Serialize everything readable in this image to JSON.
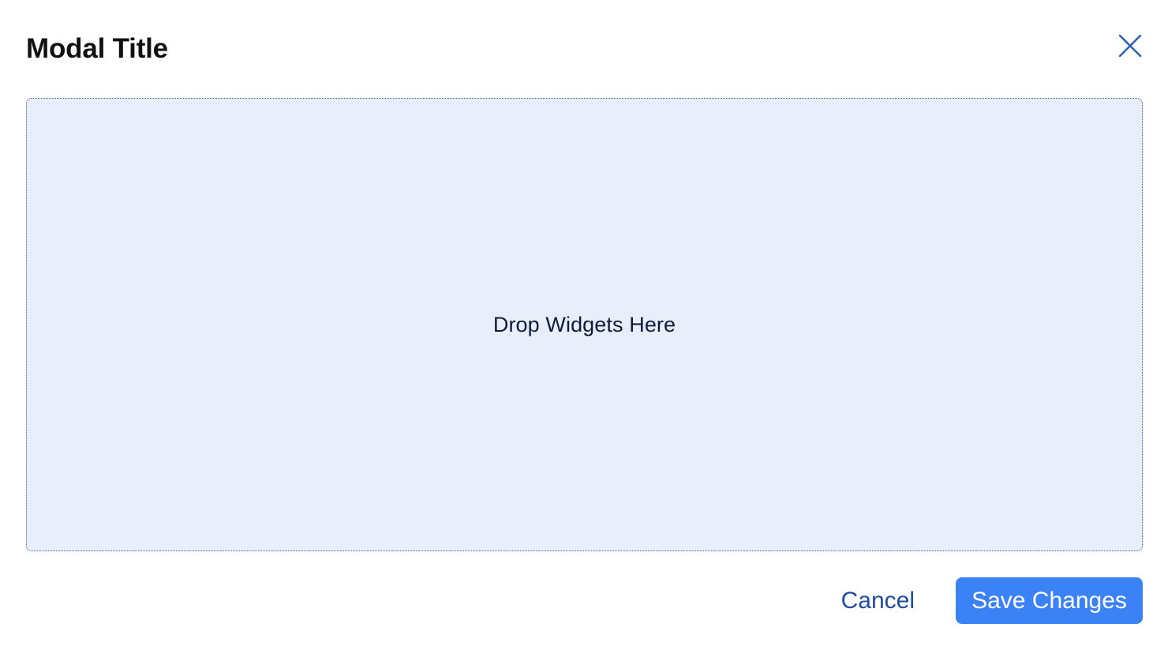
{
  "modal": {
    "title": "Modal Title",
    "close_icon": "close-icon"
  },
  "drop_zone": {
    "text": "Drop Widgets Here"
  },
  "footer": {
    "cancel_label": "Cancel",
    "save_label": "Save Changes"
  },
  "colors": {
    "accent": "#3a82f6",
    "link": "#1f4ba0",
    "drop_zone_bg": "#e8effb",
    "close_icon": "#2a5fa8"
  }
}
